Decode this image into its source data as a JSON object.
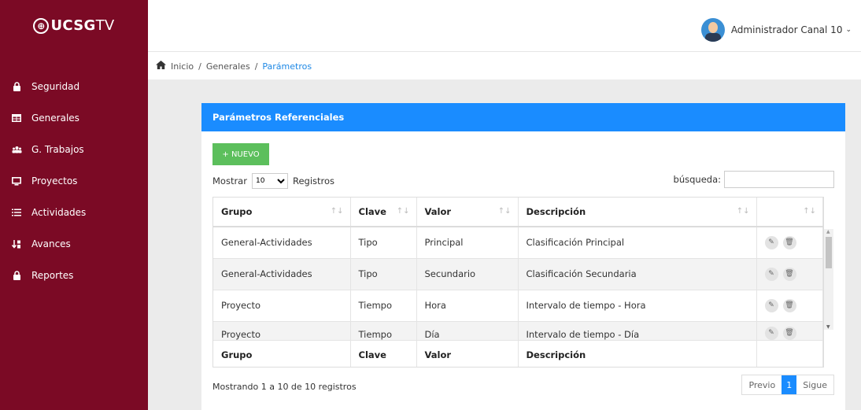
{
  "brand": {
    "mark": "⊕",
    "name": "UCSG",
    "suffix": "TV"
  },
  "sidebar": {
    "items": [
      {
        "label": "Seguridad",
        "icon": "lock-icon"
      },
      {
        "label": "Generales",
        "icon": "table-icon"
      },
      {
        "label": "G. Trabajos",
        "icon": "users-icon"
      },
      {
        "label": "Proyectos",
        "icon": "monitor-icon"
      },
      {
        "label": "Actividades",
        "icon": "list-icon"
      },
      {
        "label": "Avances",
        "icon": "sort-numeric-icon"
      },
      {
        "label": "Reportes",
        "icon": "lock-icon"
      }
    ]
  },
  "header": {
    "user_name": "Administrador Canal 10"
  },
  "breadcrumb": {
    "home": "Inicio",
    "section": "Generales",
    "current": "Parámetros"
  },
  "card": {
    "title": "Parámetros Referenciales",
    "new_button": "+ NUEVO",
    "show_label": "Mostrar",
    "show_value": "10",
    "records_label": "Registros",
    "search_label": "búsqueda:",
    "search_value": ""
  },
  "table": {
    "columns": [
      "Grupo",
      "Clave",
      "Valor",
      "Descripción"
    ],
    "rows": [
      [
        "General-Actividades",
        "Tipo",
        "Principal",
        "Clasificación Principal"
      ],
      [
        "General-Actividades",
        "Tipo",
        "Secundario",
        "Clasificación Secundaria"
      ],
      [
        "Proyecto",
        "Tiempo",
        "Hora",
        "Intervalo de tiempo - Hora"
      ],
      [
        "Proyecto",
        "Tiempo",
        "Día",
        "Intervalo de tiempo - Día"
      ]
    ]
  },
  "footer": {
    "info": "Mostrando 1 a 10 de 10 registros",
    "prev": "Previo",
    "page": "1",
    "next": "Sigue"
  },
  "colors": {
    "sidebar": "#7b0a25",
    "accent": "#1a8cff",
    "new_button": "#5cbf5c"
  }
}
